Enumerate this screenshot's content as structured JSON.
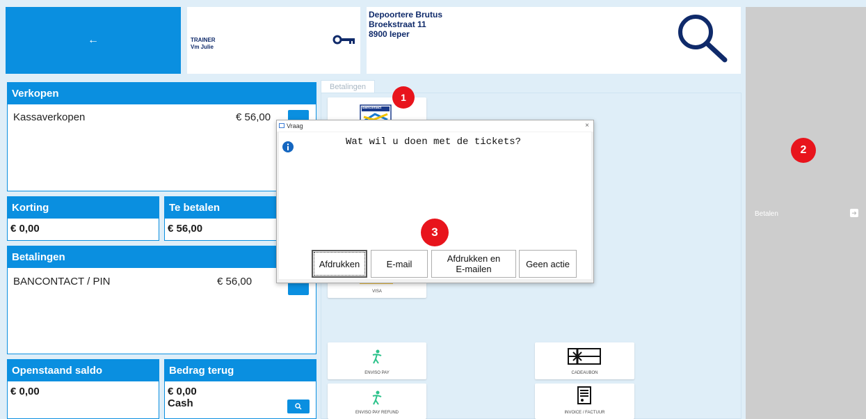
{
  "header": {
    "back_label": "←",
    "trainer_line1": "TRAINER",
    "trainer_line2": "Vm Julie",
    "customer_name": "Depoortere  Brutus",
    "customer_street": "Broekstraat 11",
    "customer_city": "8900 Ieper"
  },
  "sales": {
    "title": "Verkopen",
    "item_label": "Kassaverkopen",
    "item_amount": "€ 56,00"
  },
  "discount": {
    "title": "Korting",
    "value": "€ 0,00"
  },
  "to_pay": {
    "title": "Te betalen",
    "value": "€ 56,00"
  },
  "payments": {
    "title": "Betalingen",
    "item_label": "BANCONTACT / PIN",
    "item_amount": "€ 56,00"
  },
  "balance": {
    "title": "Openstaand saldo",
    "value": "€ 0,00"
  },
  "refund": {
    "title": "Bedrag terug",
    "value": "€ 0,00",
    "method": "Cash"
  },
  "payment_area": {
    "tab_label": "Betalingen",
    "tiles": {
      "bancontact": "Bancontact",
      "visa": "VISA",
      "enviso_pay": "ENVISO PAY",
      "enviso_refund": "ENVISO PAY REFUND",
      "gift_voucher": "CADEAUBON",
      "invoice": "INVOICE / FACTUUR"
    }
  },
  "pay_button": {
    "label": "Betalen"
  },
  "dialog": {
    "title": "Vraag",
    "close": "×",
    "message": "Wat wil u doen met de tickets?",
    "buttons": {
      "print": "Afdrukken",
      "email": "E-mail",
      "print_email_1": "Afdrukken en",
      "print_email_2": "E-mailen",
      "no_action": "Geen actie"
    }
  },
  "badges": {
    "b1": "1",
    "b2": "2",
    "b3": "3"
  },
  "colors": {
    "accent": "#0a8fe0",
    "navy": "#0f2a6a",
    "badge": "#e8141c"
  }
}
